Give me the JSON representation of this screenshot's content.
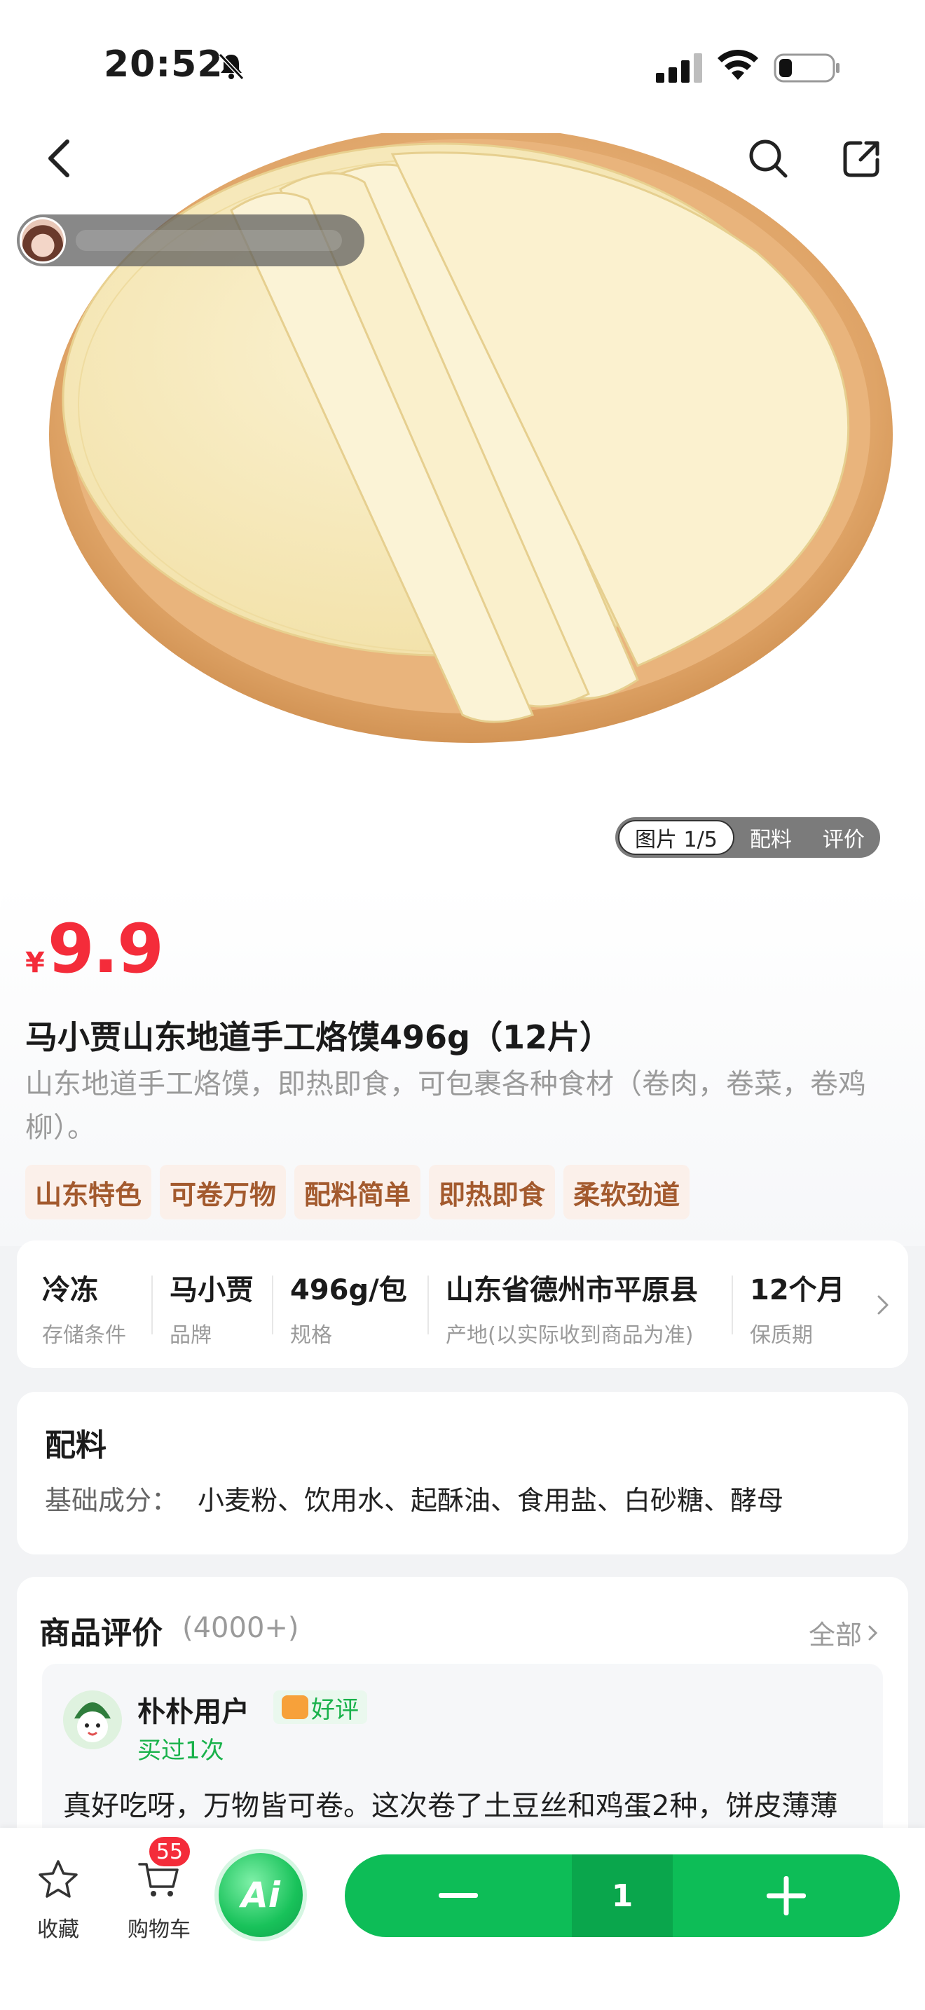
{
  "status_bar": {
    "time": "20:52"
  },
  "image_viewer": {
    "tabs": [
      {
        "label": "图片 1/5",
        "active": true
      },
      {
        "label": "配料",
        "active": false
      },
      {
        "label": "评价",
        "active": false
      }
    ]
  },
  "product": {
    "currency": "¥",
    "price": "9.9",
    "title": "马小贾山东地道手工烙馍496g（12片）",
    "subtitle": "山东地道手工烙馍，即热即食，可包裹各种食材（卷肉，卷菜，卷鸡柳）。",
    "tags": [
      "山东特色",
      "可卷万物",
      "配料简单",
      "即热即食",
      "柔软劲道"
    ]
  },
  "specs": [
    {
      "value": "冷冻",
      "key": "存储条件"
    },
    {
      "value": "马小贾",
      "key": "品牌"
    },
    {
      "value": "496g/包",
      "key": "规格"
    },
    {
      "value": "山东省德州市平原县",
      "key": "产地(以实际收到商品为准)"
    },
    {
      "value": "12个月",
      "key": "保质期"
    }
  ],
  "ingredients": {
    "title": "配料",
    "label": "基础成分：",
    "value": "小麦粉、饮用水、起酥油、食用盐、白砂糖、酵母"
  },
  "reviews": {
    "title": "商品评价",
    "count": "(4000+)",
    "all_label": "全部",
    "item": {
      "user": "朴朴用户",
      "bought": "买过1次",
      "rating_label": "好评",
      "text": "真好吃呀，万物皆可卷。这次卷了土豆丝和鸡蛋2种，饼皮薄薄的，软而筋道，有面香，卷了也不会破漏，水开蒸几分钟立"
    }
  },
  "bottom_bar": {
    "favorite_label": "收藏",
    "cart_label": "购物车",
    "cart_count": "55",
    "ai_label": "Ai",
    "quantity": "1"
  },
  "colors": {
    "price": "#f42c3a",
    "brand_green": "#0dbd57",
    "tag_text": "#a35a2e",
    "tag_bg": "#fbf0ea"
  },
  "icons": [
    "bell-muted-icon",
    "signal-icon",
    "wifi-icon",
    "battery-icon",
    "back-icon",
    "search-icon",
    "share-icon",
    "chevron-right-icon",
    "star-icon",
    "cart-icon",
    "minus-icon",
    "plus-icon"
  ]
}
